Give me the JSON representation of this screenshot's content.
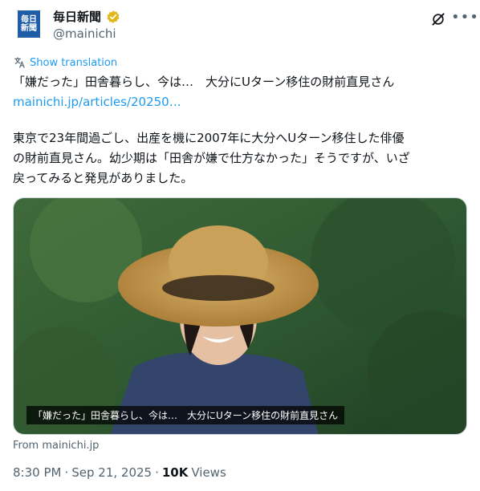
{
  "account": {
    "name": "毎日新聞",
    "handle": "@mainichi",
    "avatar_text_top": "毎日",
    "avatar_text_bottom": "新聞"
  },
  "translate_label": "Show translation",
  "tweet": {
    "headline": "「嫌だった」田舎暮らし、今は…　大分にUターン移住の財前直見さん",
    "link": "mainichi.jp/articles/20250…",
    "body_line1": "東京で23年間過ごし、出産を機に2007年に大分へUターン移住した俳優",
    "body_line2": "の財前直見さん。幼少期は「田舎が嫌で仕方なかった」そうですが、いざ",
    "body_line3": "戻ってみると発見がありました。"
  },
  "media": {
    "caption": "「嫌だった」田舎暮らし、今は…　大分にUターン移住の財前直見さん"
  },
  "card_source": "From mainichi.jp",
  "meta": {
    "time": "8:30 PM",
    "date": "Sep 21, 2025",
    "views_count": "10K",
    "views_label": "Views"
  },
  "colors": {
    "accent": "#1d9bf0",
    "verified": "#e2b719",
    "secondary_text": "#536471",
    "brand_blue": "#1f5da8"
  },
  "icons": [
    "verified-badge-icon",
    "grok-icon",
    "more-icon",
    "translate-icon"
  ]
}
